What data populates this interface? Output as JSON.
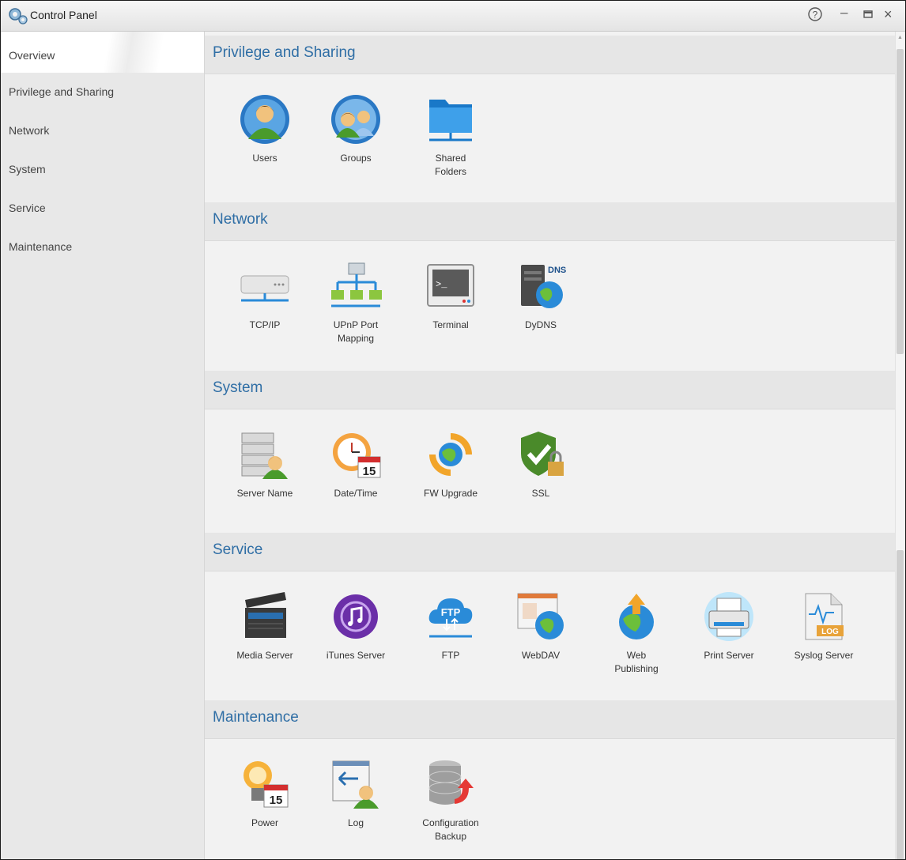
{
  "window": {
    "title": "Control Panel",
    "help_icon": "help-icon",
    "minimize_icon": "minimize-icon",
    "maximize_icon": "maximize-icon",
    "close_icon": "close-icon"
  },
  "sidebar": {
    "items": [
      {
        "label": "Overview",
        "active": true
      },
      {
        "label": "Privilege and Sharing"
      },
      {
        "label": "Network"
      },
      {
        "label": "System"
      },
      {
        "label": "Service"
      },
      {
        "label": "Maintenance"
      }
    ]
  },
  "sections": [
    {
      "title": "Privilege and Sharing",
      "items": [
        {
          "label": "Users",
          "icon": "users-icon"
        },
        {
          "label": "Groups",
          "icon": "groups-icon"
        },
        {
          "label": "Shared Folders",
          "icon": "shared-folders-icon"
        }
      ]
    },
    {
      "title": "Network",
      "items": [
        {
          "label": "TCP/IP",
          "icon": "tcpip-icon"
        },
        {
          "label": "UPnP Port Mapping",
          "icon": "upnp-icon"
        },
        {
          "label": "Terminal",
          "icon": "terminal-icon"
        },
        {
          "label": "DyDNS",
          "icon": "dydns-icon",
          "badge": "DNS"
        }
      ]
    },
    {
      "title": "System",
      "items": [
        {
          "label": "Server Name",
          "icon": "server-name-icon"
        },
        {
          "label": "Date/Time",
          "icon": "date-time-icon",
          "badge": "15"
        },
        {
          "label": "FW Upgrade",
          "icon": "fw-upgrade-icon"
        },
        {
          "label": "SSL",
          "icon": "ssl-icon"
        }
      ]
    },
    {
      "title": "Service",
      "items": [
        {
          "label": "Media Server",
          "icon": "media-server-icon"
        },
        {
          "label": "iTunes Server",
          "icon": "itunes-server-icon"
        },
        {
          "label": "FTP",
          "icon": "ftp-icon",
          "badge": "FTP"
        },
        {
          "label": "WebDAV",
          "icon": "webdav-icon"
        },
        {
          "label": "Web Publishing",
          "icon": "web-publishing-icon"
        },
        {
          "label": "Print Server",
          "icon": "print-server-icon"
        },
        {
          "label": "Syslog Server",
          "icon": "syslog-server-icon",
          "badge": "LOG"
        }
      ]
    },
    {
      "title": "Maintenance",
      "items": [
        {
          "label": "Power",
          "icon": "power-icon",
          "badge": "15"
        },
        {
          "label": "Log",
          "icon": "log-icon"
        },
        {
          "label": "Configuration Backup",
          "icon": "configuration-backup-icon"
        }
      ]
    }
  ],
  "colors": {
    "accent": "#2f6ea5",
    "sidebar_bg": "#e8e8e8",
    "main_bg": "#f2f2f2",
    "header_bg": "#e6e6e6"
  }
}
